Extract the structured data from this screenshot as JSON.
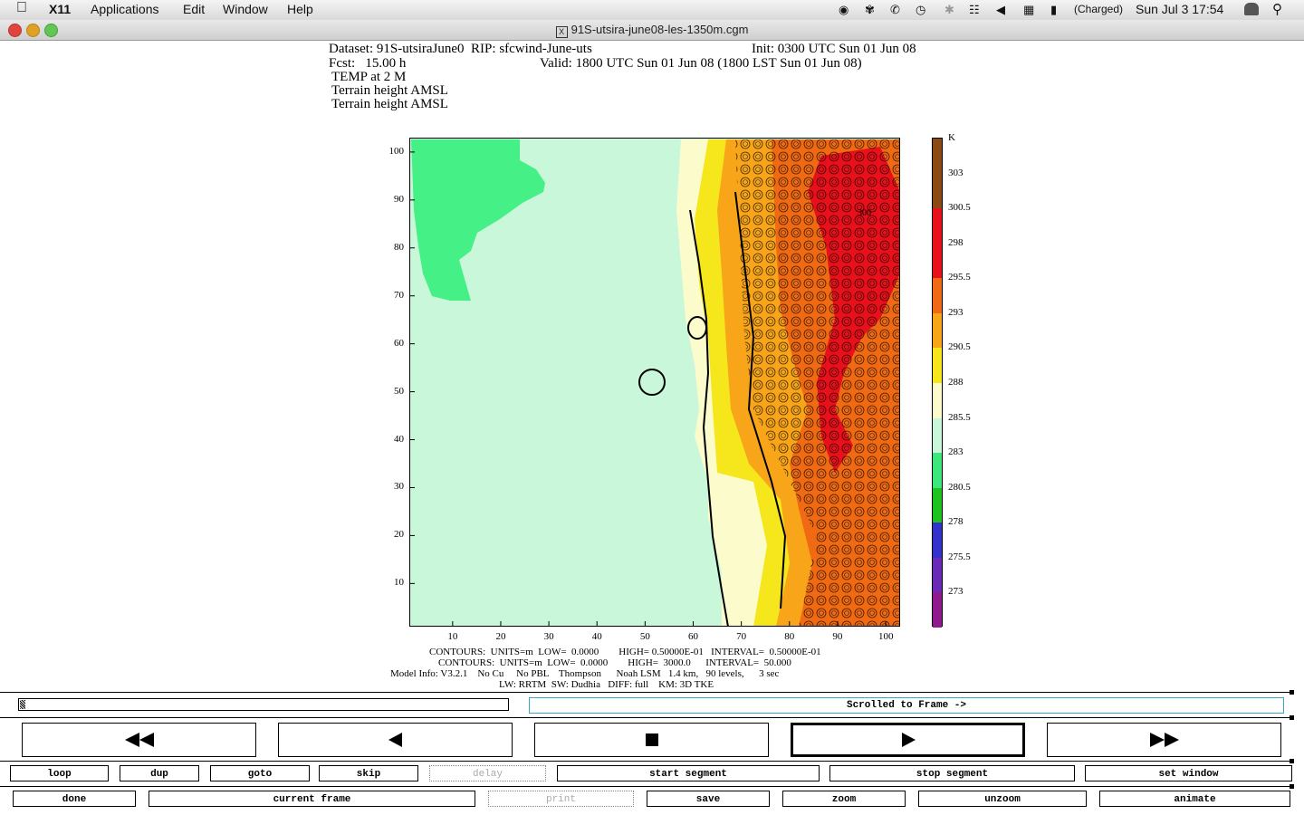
{
  "menubar": {
    "apple": "",
    "app": "X11",
    "items": [
      "Applications",
      "Edit",
      "Window",
      "Help"
    ],
    "battery": "(Charged)",
    "clock": "Sun Jul 3  17:54"
  },
  "window": {
    "title": "91S-utsira-june08-les-1350m.cgm"
  },
  "plot_header": {
    "dataset": "Dataset: 91S-utsiraJune0  RIP: sfcwind-June-uts",
    "init": "Init: 0300 UTC Sun 01 Jun 08",
    "fcst": "Fcst:   15.00 h",
    "valid": "Valid: 1800 UTC Sun 01 Jun 08 (1800 LST Sun 01 Jun 08)",
    "var1": "TEMP at 2 M",
    "var2": "Terrain height AMSL",
    "var3": "Terrain height AMSL"
  },
  "chart_data": {
    "type": "heatmap",
    "x_ticks": [
      "10",
      "20",
      "30",
      "40",
      "50",
      "60",
      "70",
      "80",
      "90",
      "100"
    ],
    "y_ticks": [
      "100",
      "90",
      "80",
      "70",
      "60",
      "50",
      "40",
      "30",
      "20",
      "10"
    ],
    "xlim": [
      1,
      103
    ],
    "ylim": [
      1,
      103
    ],
    "contour_label": "300",
    "colorbar": {
      "unit": "K",
      "labels": [
        "303",
        "300.5",
        "298",
        "295.5",
        "293",
        "290.5",
        "288",
        "285.5",
        "283",
        "280.5",
        "278",
        "275.5",
        "273"
      ],
      "colors": [
        "#8b4a14",
        "#e8101a",
        "#e8101a",
        "#f06a14",
        "#f9a519",
        "#f5e71c",
        "#fbfbcc",
        "#c9f7d9",
        "#3ce77c",
        "#1fc31f",
        "#3333cc",
        "#6a2ab8",
        "#8e1a8e"
      ]
    }
  },
  "plot_footer": {
    "line1": "CONTOURS:  UNITS=m  LOW=  0.0000        HIGH= 0.50000E-01   INTERVAL=  0.50000E-01",
    "line2": "CONTOURS:  UNITS=m  LOW=  0.0000        HIGH=  3000.0      INTERVAL=  50.000",
    "line3": "Model Info: V3.2.1    No Cu     No PBL    Thompson      Noah LSM   1.4 km,   90 levels,      3 sec",
    "line4": "LW: RRTM  SW: Dudhia   DIFF: full    KM: 3D TKE"
  },
  "controls": {
    "status": "Scrolled to Frame ->",
    "row1": [
      "loop",
      "dup",
      "goto",
      "skip",
      "delay",
      "start segment",
      "stop segment",
      "set window"
    ],
    "row2": [
      "done",
      "current frame",
      "print",
      "save",
      "zoom",
      "unzoom",
      "animate"
    ]
  }
}
